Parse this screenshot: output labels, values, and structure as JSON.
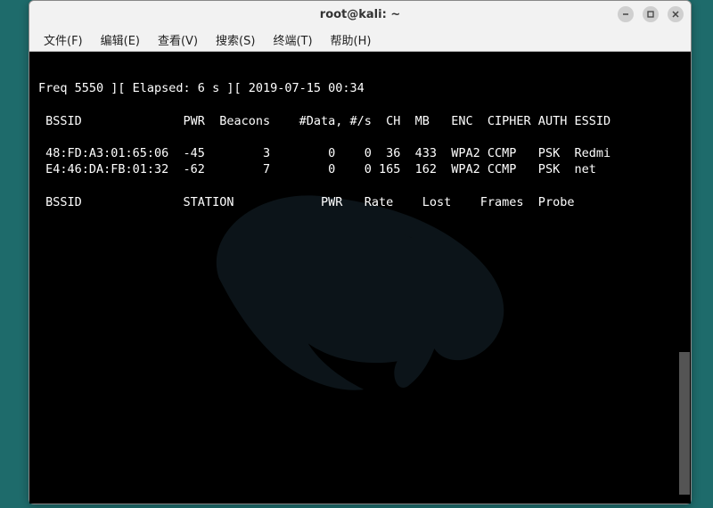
{
  "window": {
    "title": "root@kali: ~"
  },
  "menu": {
    "file": "文件(F)",
    "edit": "编辑(E)",
    "view": "查看(V)",
    "search": "搜索(S)",
    "terminal": "终端(T)",
    "help": "帮助(H)"
  },
  "terminal": {
    "statusline": "Freq 5550 ][ Elapsed: 6 s ][ 2019-07-15 00:34",
    "header1": " BSSID              PWR  Beacons    #Data, #/s  CH  MB   ENC  CIPHER AUTH ESSID",
    "row1": " 48:FD:A3:01:65:06  -45        3        0    0  36  433  WPA2 CCMP   PSK  Redmi",
    "row2": " E4:46:DA:FB:01:32  -62        7        0    0 165  162  WPA2 CCMP   PSK  net",
    "header2": " BSSID              STATION            PWR   Rate    Lost    Frames  Probe"
  },
  "networks": [
    {
      "bssid": "48:FD:A3:01:65:06",
      "pwr": -45,
      "beacons": 3,
      "data": 0,
      "per_s": 0,
      "ch": 36,
      "mb": 433,
      "enc": "WPA2",
      "cipher": "CCMP",
      "auth": "PSK",
      "essid": "Redmi"
    },
    {
      "bssid": "E4:46:DA:FB:01:32",
      "pwr": -62,
      "beacons": 7,
      "data": 0,
      "per_s": 0,
      "ch": 165,
      "mb": 162,
      "enc": "WPA2",
      "cipher": "CCMP",
      "auth": "PSK",
      "essid": "net"
    }
  ]
}
